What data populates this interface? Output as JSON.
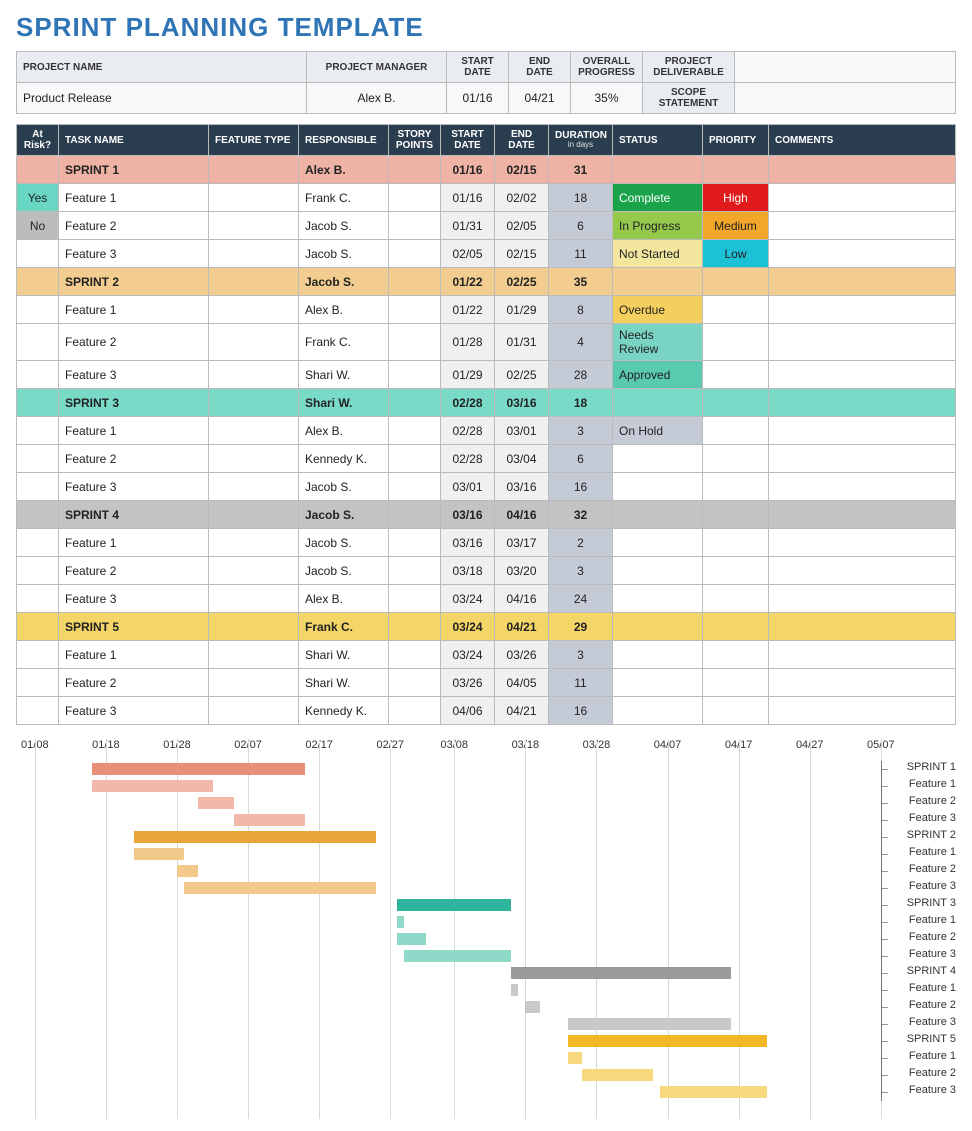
{
  "title": "SPRINT PLANNING TEMPLATE",
  "meta": {
    "headers": [
      "PROJECT NAME",
      "PROJECT MANAGER",
      "START DATE",
      "END DATE",
      "OVERALL PROGRESS",
      "PROJECT DELIVERABLE",
      "SCOPE STATEMENT"
    ],
    "project_name": "Product Release",
    "project_manager": "Alex B.",
    "start_date": "01/16",
    "end_date": "04/21",
    "overall_progress": "35%",
    "project_deliverable": "",
    "scope_statement": ""
  },
  "task_headers": [
    "At Risk?",
    "TASK NAME",
    "FEATURE TYPE",
    "RESPONSIBLE",
    "STORY POINTS",
    "START DATE",
    "END DATE",
    "DURATION",
    "STATUS",
    "PRIORITY",
    "COMMENTS"
  ],
  "task_header_sub": "in days",
  "rows": [
    {
      "type": "sprint",
      "risk": "",
      "name": "SPRINT 1",
      "feature": "",
      "resp": "Alex B.",
      "points": "",
      "start": "01/16",
      "end": "02/15",
      "dur": "31",
      "status": "",
      "priority": "",
      "comments": "",
      "color": "#efb3a6"
    },
    {
      "type": "task",
      "risk": "Yes",
      "name": "Feature 1",
      "feature": "",
      "resp": "Frank C.",
      "points": "",
      "start": "01/16",
      "end": "02/02",
      "dur": "18",
      "status": "Complete",
      "priority": "High",
      "comments": ""
    },
    {
      "type": "task",
      "risk": "No",
      "name": "Feature 2",
      "feature": "",
      "resp": "Jacob S.",
      "points": "",
      "start": "01/31",
      "end": "02/05",
      "dur": "6",
      "status": "In Progress",
      "priority": "Medium",
      "comments": ""
    },
    {
      "type": "task",
      "risk": "",
      "name": "Feature 3",
      "feature": "",
      "resp": "Jacob S.",
      "points": "",
      "start": "02/05",
      "end": "02/15",
      "dur": "11",
      "status": "Not Started",
      "priority": "Low",
      "comments": ""
    },
    {
      "type": "sprint",
      "risk": "",
      "name": "SPRINT 2",
      "feature": "",
      "resp": "Jacob S.",
      "points": "",
      "start": "01/22",
      "end": "02/25",
      "dur": "35",
      "status": "",
      "priority": "",
      "comments": "",
      "color": "#f2cd8f"
    },
    {
      "type": "task",
      "risk": "",
      "name": "Feature 1",
      "feature": "",
      "resp": "Alex B.",
      "points": "",
      "start": "01/22",
      "end": "01/29",
      "dur": "8",
      "status": "Overdue",
      "priority": "",
      "comments": ""
    },
    {
      "type": "task",
      "risk": "",
      "name": "Feature 2",
      "feature": "",
      "resp": "Frank C.",
      "points": "",
      "start": "01/28",
      "end": "01/31",
      "dur": "4",
      "status": "Needs Review",
      "priority": "",
      "comments": ""
    },
    {
      "type": "task",
      "risk": "",
      "name": "Feature 3",
      "feature": "",
      "resp": "Shari W.",
      "points": "",
      "start": "01/29",
      "end": "02/25",
      "dur": "28",
      "status": "Approved",
      "priority": "",
      "comments": ""
    },
    {
      "type": "sprint",
      "risk": "",
      "name": "SPRINT 3",
      "feature": "",
      "resp": "Shari W.",
      "points": "",
      "start": "02/28",
      "end": "03/16",
      "dur": "18",
      "status": "",
      "priority": "",
      "comments": "",
      "color": "#79dbc7"
    },
    {
      "type": "task",
      "risk": "",
      "name": "Feature 1",
      "feature": "",
      "resp": "Alex B.",
      "points": "",
      "start": "02/28",
      "end": "03/01",
      "dur": "3",
      "status": "On Hold",
      "priority": "",
      "comments": ""
    },
    {
      "type": "task",
      "risk": "",
      "name": "Feature 2",
      "feature": "",
      "resp": "Kennedy K.",
      "points": "",
      "start": "02/28",
      "end": "03/04",
      "dur": "6",
      "status": "",
      "priority": "",
      "comments": ""
    },
    {
      "type": "task",
      "risk": "",
      "name": "Feature 3",
      "feature": "",
      "resp": "Jacob S.",
      "points": "",
      "start": "03/01",
      "end": "03/16",
      "dur": "16",
      "status": "",
      "priority": "",
      "comments": ""
    },
    {
      "type": "sprint",
      "risk": "",
      "name": "SPRINT 4",
      "feature": "",
      "resp": "Jacob S.",
      "points": "",
      "start": "03/16",
      "end": "04/16",
      "dur": "32",
      "status": "",
      "priority": "",
      "comments": "",
      "color": "#c3c3c3"
    },
    {
      "type": "task",
      "risk": "",
      "name": "Feature 1",
      "feature": "",
      "resp": "Jacob S.",
      "points": "",
      "start": "03/16",
      "end": "03/17",
      "dur": "2",
      "status": "",
      "priority": "",
      "comments": ""
    },
    {
      "type": "task",
      "risk": "",
      "name": "Feature 2",
      "feature": "",
      "resp": "Jacob S.",
      "points": "",
      "start": "03/18",
      "end": "03/20",
      "dur": "3",
      "status": "",
      "priority": "",
      "comments": ""
    },
    {
      "type": "task",
      "risk": "",
      "name": "Feature 3",
      "feature": "",
      "resp": "Alex B.",
      "points": "",
      "start": "03/24",
      "end": "04/16",
      "dur": "24",
      "status": "",
      "priority": "",
      "comments": ""
    },
    {
      "type": "sprint",
      "risk": "",
      "name": "SPRINT 5",
      "feature": "",
      "resp": "Frank C.",
      "points": "",
      "start": "03/24",
      "end": "04/21",
      "dur": "29",
      "status": "",
      "priority": "",
      "comments": "",
      "color": "#f4d567"
    },
    {
      "type": "task",
      "risk": "",
      "name": "Feature 1",
      "feature": "",
      "resp": "Shari W.",
      "points": "",
      "start": "03/24",
      "end": "03/26",
      "dur": "3",
      "status": "",
      "priority": "",
      "comments": ""
    },
    {
      "type": "task",
      "risk": "",
      "name": "Feature 2",
      "feature": "",
      "resp": "Shari W.",
      "points": "",
      "start": "03/26",
      "end": "04/05",
      "dur": "11",
      "status": "",
      "priority": "",
      "comments": ""
    },
    {
      "type": "task",
      "risk": "",
      "name": "Feature 3",
      "feature": "",
      "resp": "Kennedy K.",
      "points": "",
      "start": "04/06",
      "end": "04/21",
      "dur": "16",
      "status": "",
      "priority": "",
      "comments": ""
    }
  ],
  "chart_data": {
    "type": "bar",
    "title": "",
    "xlabel": "",
    "ylabel": "",
    "x_ticks": [
      "01/08",
      "01/18",
      "01/28",
      "02/07",
      "02/17",
      "02/27",
      "03/08",
      "03/18",
      "03/28",
      "04/07",
      "04/17",
      "04/27",
      "05/07"
    ],
    "x_min": "01/08",
    "x_max": "05/07",
    "series": [
      {
        "name": "SPRINT 1",
        "start": "01/16",
        "end": "02/15",
        "color": "#e88f7a",
        "light": "#f2b8a9"
      },
      {
        "name": "Feature 1",
        "start": "01/16",
        "end": "02/02",
        "color": "#e88f7a",
        "light": "#f2b8a9"
      },
      {
        "name": "Feature 2",
        "start": "01/31",
        "end": "02/05",
        "color": "#e88f7a",
        "light": "#f2b8a9"
      },
      {
        "name": "Feature 3",
        "start": "02/05",
        "end": "02/15",
        "color": "#e88f7a",
        "light": "#f2b8a9"
      },
      {
        "name": "SPRINT 2",
        "start": "01/22",
        "end": "02/25",
        "color": "#e9a43a",
        "light": "#f2c98a"
      },
      {
        "name": "Feature 1",
        "start": "01/22",
        "end": "01/29",
        "color": "#e9a43a",
        "light": "#f2c98a"
      },
      {
        "name": "Feature 2",
        "start": "01/28",
        "end": "01/31",
        "color": "#e9a43a",
        "light": "#f2c98a"
      },
      {
        "name": "Feature 3",
        "start": "01/29",
        "end": "02/25",
        "color": "#e9a43a",
        "light": "#f2c98a"
      },
      {
        "name": "SPRINT 3",
        "start": "02/28",
        "end": "03/16",
        "color": "#2fb59b",
        "light": "#8fd9c9"
      },
      {
        "name": "Feature 1",
        "start": "02/28",
        "end": "03/01",
        "color": "#2fb59b",
        "light": "#8fd9c9"
      },
      {
        "name": "Feature 2",
        "start": "02/28",
        "end": "03/04",
        "color": "#2fb59b",
        "light": "#8fd9c9"
      },
      {
        "name": "Feature 3",
        "start": "03/01",
        "end": "03/16",
        "color": "#2fb59b",
        "light": "#8fd9c9"
      },
      {
        "name": "SPRINT 4",
        "start": "03/16",
        "end": "04/16",
        "color": "#9a9a9a",
        "light": "#c9c9c9"
      },
      {
        "name": "Feature 1",
        "start": "03/16",
        "end": "03/17",
        "color": "#9a9a9a",
        "light": "#c9c9c9"
      },
      {
        "name": "Feature 2",
        "start": "03/18",
        "end": "03/20",
        "color": "#9a9a9a",
        "light": "#c9c9c9"
      },
      {
        "name": "Feature 3",
        "start": "03/24",
        "end": "04/16",
        "color": "#9a9a9a",
        "light": "#c9c9c9"
      },
      {
        "name": "SPRINT 5",
        "start": "03/24",
        "end": "04/21",
        "color": "#f2b827",
        "light": "#f7d87e"
      },
      {
        "name": "Feature 1",
        "start": "03/24",
        "end": "03/26",
        "color": "#f2b827",
        "light": "#f7d87e"
      },
      {
        "name": "Feature 2",
        "start": "03/26",
        "end": "04/05",
        "color": "#f2b827",
        "light": "#f7d87e"
      },
      {
        "name": "Feature 3",
        "start": "04/06",
        "end": "04/21",
        "color": "#f2b827",
        "light": "#f7d87e"
      }
    ]
  }
}
